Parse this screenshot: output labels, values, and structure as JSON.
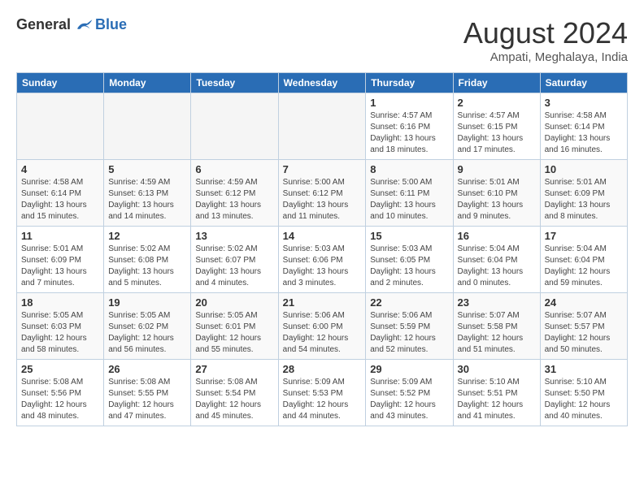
{
  "header": {
    "logo_general": "General",
    "logo_blue": "Blue",
    "month_title": "August 2024",
    "location": "Ampati, Meghalaya, India"
  },
  "days_of_week": [
    "Sunday",
    "Monday",
    "Tuesday",
    "Wednesday",
    "Thursday",
    "Friday",
    "Saturday"
  ],
  "weeks": [
    [
      {
        "day": "",
        "info": ""
      },
      {
        "day": "",
        "info": ""
      },
      {
        "day": "",
        "info": ""
      },
      {
        "day": "",
        "info": ""
      },
      {
        "day": "1",
        "info": "Sunrise: 4:57 AM\nSunset: 6:16 PM\nDaylight: 13 hours\nand 18 minutes."
      },
      {
        "day": "2",
        "info": "Sunrise: 4:57 AM\nSunset: 6:15 PM\nDaylight: 13 hours\nand 17 minutes."
      },
      {
        "day": "3",
        "info": "Sunrise: 4:58 AM\nSunset: 6:14 PM\nDaylight: 13 hours\nand 16 minutes."
      }
    ],
    [
      {
        "day": "4",
        "info": "Sunrise: 4:58 AM\nSunset: 6:14 PM\nDaylight: 13 hours\nand 15 minutes."
      },
      {
        "day": "5",
        "info": "Sunrise: 4:59 AM\nSunset: 6:13 PM\nDaylight: 13 hours\nand 14 minutes."
      },
      {
        "day": "6",
        "info": "Sunrise: 4:59 AM\nSunset: 6:12 PM\nDaylight: 13 hours\nand 13 minutes."
      },
      {
        "day": "7",
        "info": "Sunrise: 5:00 AM\nSunset: 6:12 PM\nDaylight: 13 hours\nand 11 minutes."
      },
      {
        "day": "8",
        "info": "Sunrise: 5:00 AM\nSunset: 6:11 PM\nDaylight: 13 hours\nand 10 minutes."
      },
      {
        "day": "9",
        "info": "Sunrise: 5:01 AM\nSunset: 6:10 PM\nDaylight: 13 hours\nand 9 minutes."
      },
      {
        "day": "10",
        "info": "Sunrise: 5:01 AM\nSunset: 6:09 PM\nDaylight: 13 hours\nand 8 minutes."
      }
    ],
    [
      {
        "day": "11",
        "info": "Sunrise: 5:01 AM\nSunset: 6:09 PM\nDaylight: 13 hours\nand 7 minutes."
      },
      {
        "day": "12",
        "info": "Sunrise: 5:02 AM\nSunset: 6:08 PM\nDaylight: 13 hours\nand 5 minutes."
      },
      {
        "day": "13",
        "info": "Sunrise: 5:02 AM\nSunset: 6:07 PM\nDaylight: 13 hours\nand 4 minutes."
      },
      {
        "day": "14",
        "info": "Sunrise: 5:03 AM\nSunset: 6:06 PM\nDaylight: 13 hours\nand 3 minutes."
      },
      {
        "day": "15",
        "info": "Sunrise: 5:03 AM\nSunset: 6:05 PM\nDaylight: 13 hours\nand 2 minutes."
      },
      {
        "day": "16",
        "info": "Sunrise: 5:04 AM\nSunset: 6:04 PM\nDaylight: 13 hours\nand 0 minutes."
      },
      {
        "day": "17",
        "info": "Sunrise: 5:04 AM\nSunset: 6:04 PM\nDaylight: 12 hours\nand 59 minutes."
      }
    ],
    [
      {
        "day": "18",
        "info": "Sunrise: 5:05 AM\nSunset: 6:03 PM\nDaylight: 12 hours\nand 58 minutes."
      },
      {
        "day": "19",
        "info": "Sunrise: 5:05 AM\nSunset: 6:02 PM\nDaylight: 12 hours\nand 56 minutes."
      },
      {
        "day": "20",
        "info": "Sunrise: 5:05 AM\nSunset: 6:01 PM\nDaylight: 12 hours\nand 55 minutes."
      },
      {
        "day": "21",
        "info": "Sunrise: 5:06 AM\nSunset: 6:00 PM\nDaylight: 12 hours\nand 54 minutes."
      },
      {
        "day": "22",
        "info": "Sunrise: 5:06 AM\nSunset: 5:59 PM\nDaylight: 12 hours\nand 52 minutes."
      },
      {
        "day": "23",
        "info": "Sunrise: 5:07 AM\nSunset: 5:58 PM\nDaylight: 12 hours\nand 51 minutes."
      },
      {
        "day": "24",
        "info": "Sunrise: 5:07 AM\nSunset: 5:57 PM\nDaylight: 12 hours\nand 50 minutes."
      }
    ],
    [
      {
        "day": "25",
        "info": "Sunrise: 5:08 AM\nSunset: 5:56 PM\nDaylight: 12 hours\nand 48 minutes."
      },
      {
        "day": "26",
        "info": "Sunrise: 5:08 AM\nSunset: 5:55 PM\nDaylight: 12 hours\nand 47 minutes."
      },
      {
        "day": "27",
        "info": "Sunrise: 5:08 AM\nSunset: 5:54 PM\nDaylight: 12 hours\nand 45 minutes."
      },
      {
        "day": "28",
        "info": "Sunrise: 5:09 AM\nSunset: 5:53 PM\nDaylight: 12 hours\nand 44 minutes."
      },
      {
        "day": "29",
        "info": "Sunrise: 5:09 AM\nSunset: 5:52 PM\nDaylight: 12 hours\nand 43 minutes."
      },
      {
        "day": "30",
        "info": "Sunrise: 5:10 AM\nSunset: 5:51 PM\nDaylight: 12 hours\nand 41 minutes."
      },
      {
        "day": "31",
        "info": "Sunrise: 5:10 AM\nSunset: 5:50 PM\nDaylight: 12 hours\nand 40 minutes."
      }
    ]
  ]
}
